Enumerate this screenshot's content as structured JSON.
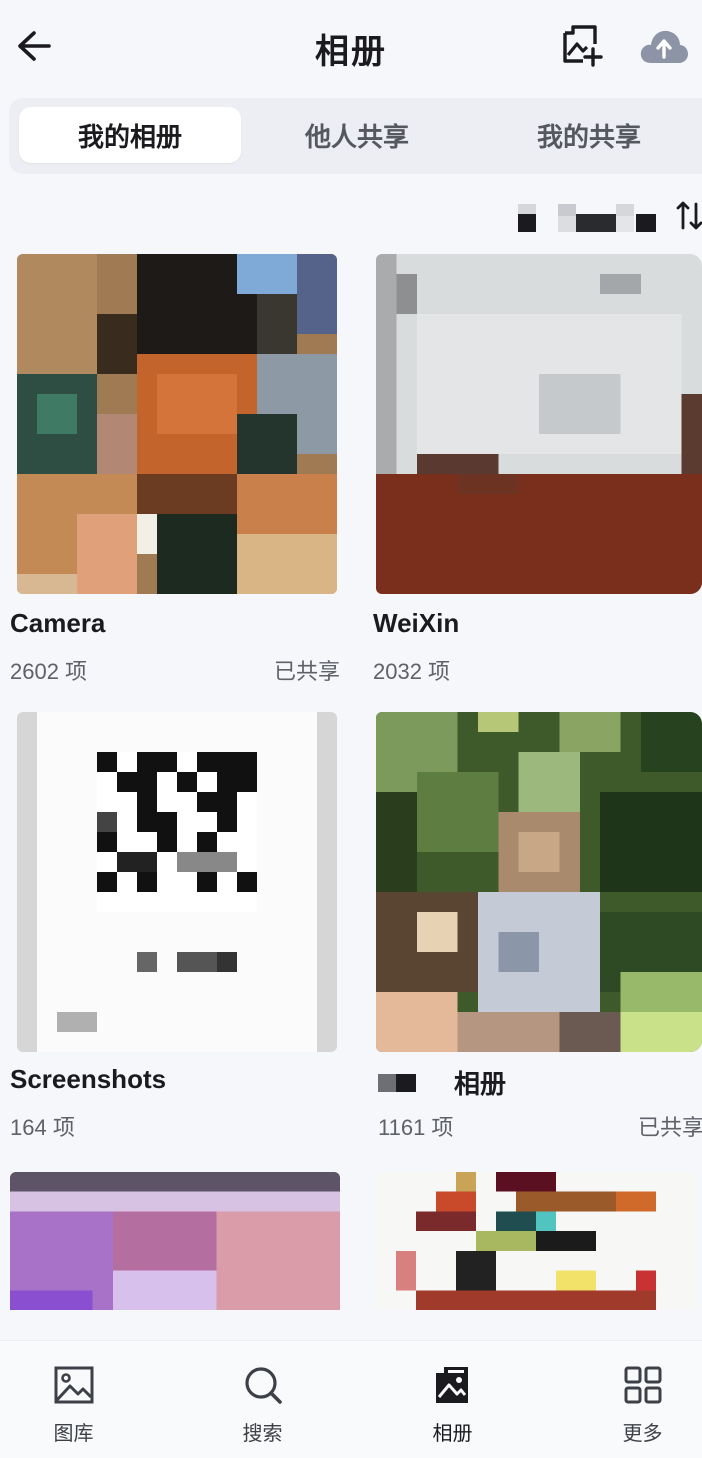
{
  "header": {
    "title": "相册",
    "back_icon": "arrow-left-icon",
    "add_icon": "add-album-icon",
    "cloud_icon": "cloud-upload-icon"
  },
  "tabs": [
    {
      "label": "我的相册",
      "active": true
    },
    {
      "label": "他人共享",
      "active": false
    },
    {
      "label": "我的共享",
      "active": false
    }
  ],
  "sort": {
    "icon": "sort-icon"
  },
  "albums": [
    {
      "name": "Camera",
      "count": "2602 项",
      "shared": "已共享"
    },
    {
      "name": "WeiXin",
      "count": "2032 项",
      "shared": ""
    },
    {
      "name": "Screenshots",
      "count": "164 项",
      "shared": ""
    },
    {
      "name": "相册",
      "count": "1161 项",
      "shared": "已共享"
    }
  ],
  "bottom_nav": [
    {
      "label": "图库",
      "icon": "image-icon",
      "active": false
    },
    {
      "label": "搜索",
      "icon": "search-icon",
      "active": false
    },
    {
      "label": "相册",
      "icon": "album-icon",
      "active": true
    },
    {
      "label": "更多",
      "icon": "grid-icon",
      "active": false
    }
  ],
  "colors": {
    "background": "#f6f7fb",
    "tab_bar": "#eceef3",
    "text_primary": "#1b1b1f",
    "text_secondary": "#5e6168",
    "cloud_icon": "#8c94a6"
  }
}
